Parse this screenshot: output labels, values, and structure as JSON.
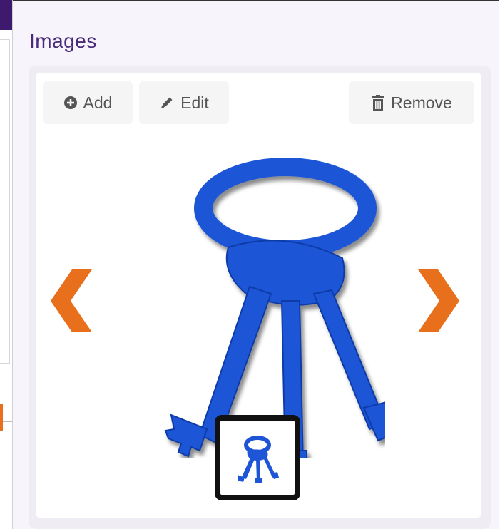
{
  "section": {
    "title": "Images"
  },
  "toolbar": {
    "add_label": "Add",
    "edit_label": "Edit",
    "remove_label": "Remove"
  },
  "gallery": {
    "main_image_icon": "keys-icon",
    "prev_icon": "chevron-left-icon",
    "next_icon": "chevron-right-icon",
    "thumbnail_icon": "keys-icon"
  },
  "colors": {
    "title": "#4a2a7a",
    "arrow": "#e8701c",
    "keys": "#1d55d6",
    "thumbnail_border": "#111111"
  }
}
